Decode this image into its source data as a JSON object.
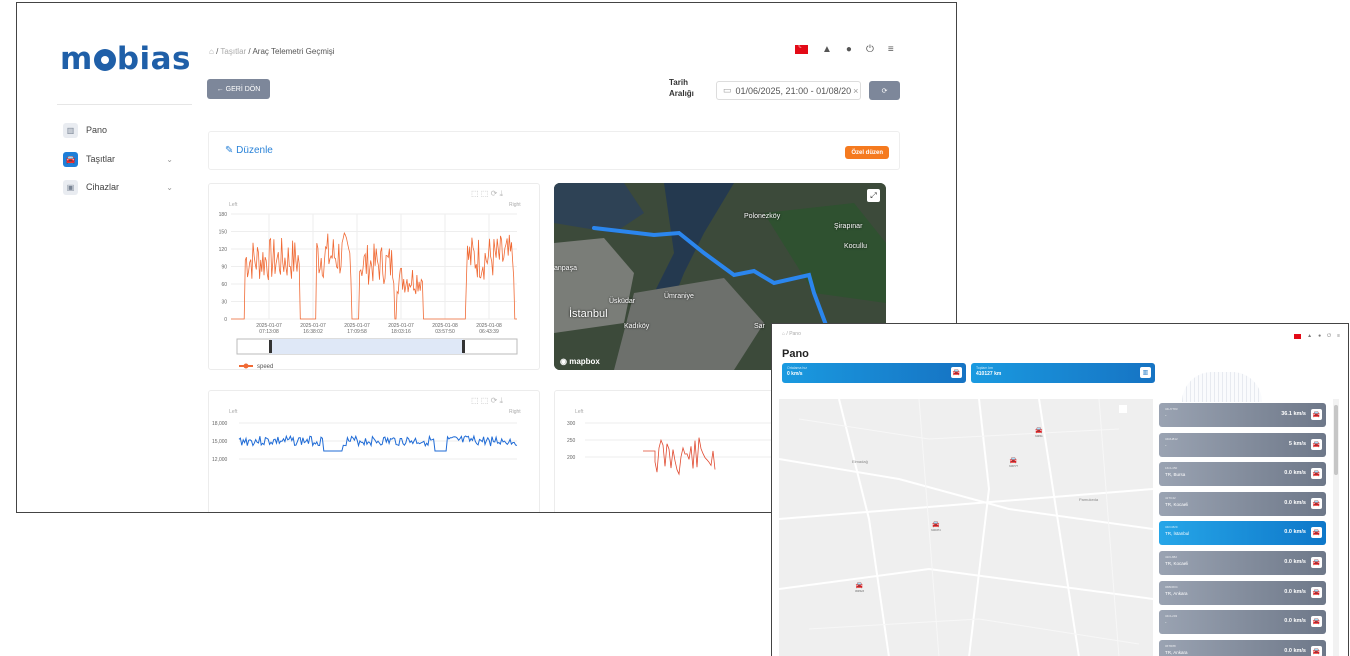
{
  "back_window": {
    "logo": {
      "pre": "m",
      "post": "bias"
    },
    "sidebar": [
      {
        "label": "Pano",
        "icon": "chart-icon",
        "glyph": "▥",
        "active": false
      },
      {
        "label": "Taşıtlar",
        "icon": "car-icon",
        "glyph": "🚘",
        "active": true
      },
      {
        "label": "Cihazlar",
        "icon": "device-icon",
        "glyph": "▣",
        "active": false
      }
    ],
    "breadcrumb": {
      "home": "⌂",
      "sep": "/",
      "parent": "Taşıtlar",
      "current": "Araç Telemetri Geçmişi"
    },
    "back_button": "← GERİ DÖN",
    "date": {
      "label_line1": "Tarih",
      "label_line2": "Aralığı",
      "value": "01/06/2025, 21:00 - 01/08/20",
      "clear": "×",
      "cal": "▭"
    },
    "edit": {
      "label": "Düzenle",
      "icon": "✎",
      "custom_btn": "Özel düzen"
    },
    "map": {
      "brand": "mapbox",
      "expand": "⤢",
      "labels": [
        "Polonezköy",
        "Şirapınar",
        "Kocullu",
        "Üsküdar",
        "Ümraniye",
        "İstanbul",
        "Kadıköy",
        "Sar",
        "anpaşa"
      ]
    }
  },
  "charts": {
    "speed": {
      "type": "line",
      "toolbar": "⬚ ⬚ ⟳ ⤓",
      "left_label": "Left",
      "right_label": "Right",
      "ylim": [
        0,
        180
      ],
      "yticks": [
        "180",
        "150",
        "120",
        "90",
        "60",
        "30",
        "0"
      ],
      "xticks": [
        [
          "2025-01-07",
          "07:13:08"
        ],
        [
          "2025-01-07",
          "16:38:02"
        ],
        [
          "2025-01-07",
          "17:09:58"
        ],
        [
          "2025-01-07",
          "18:03:16"
        ],
        [
          "2025-01-08",
          "03:57:50"
        ],
        [
          "2025-01-08",
          "06:43:39"
        ]
      ],
      "series": [
        {
          "name": "speed",
          "color": "#f06a35"
        }
      ],
      "bursts": [
        [
          0.05,
          0.24,
          140
        ],
        [
          0.3,
          0.42,
          150
        ],
        [
          0.45,
          0.57,
          130
        ],
        [
          0.58,
          0.67,
          95
        ],
        [
          0.82,
          0.99,
          145
        ]
      ]
    },
    "bottom_left": {
      "type": "line",
      "toolbar": "⬚ ⬚ ⟳ ⤓",
      "left_label": "Left",
      "right_label": "Right",
      "yticks": [
        "18,000",
        "15,000",
        "12,000"
      ],
      "color": "#1f6bd6"
    },
    "bottom_right": {
      "type": "line",
      "left_label": "Left",
      "yticks": [
        "300",
        "250",
        "200"
      ],
      "color": "#e0492f"
    }
  },
  "front_window": {
    "breadcrumb": "⌂ / Pano",
    "title": "Pano",
    "stats": [
      {
        "label": "Ortalama hız",
        "value": "0 km/s",
        "icon": "car-icon",
        "glyph": "🚘"
      },
      {
        "label": "Toplam km",
        "value": "410127 km",
        "icon": "chart-icon",
        "glyph": "▥"
      }
    ],
    "map_cars": [
      {
        "code": "34RS1",
        "x": 256,
        "y": 30
      },
      {
        "code": "34KH77",
        "x": 230,
        "y": 60
      },
      {
        "code": "34DCH4",
        "x": 152,
        "y": 124
      },
      {
        "code": "06RS23",
        "x": 76,
        "y": 185
      }
    ],
    "map_labels": [
      "Elmadağ",
      "Pamukeda"
    ],
    "vehicles": [
      {
        "code": "34HY783",
        "city": "-",
        "speed": "36.1 km/s",
        "active": false
      },
      {
        "code": "34RH812",
        "city": "-",
        "speed": "5 km/s",
        "active": false
      },
      {
        "code": "16CL450",
        "city": "TR, Bursa",
        "speed": "0.0 km/s",
        "active": false
      },
      {
        "code": "41TC42",
        "city": "TR, Kocaeli",
        "speed": "0.0 km/s",
        "active": false
      },
      {
        "code": "34KC829",
        "city": "TR, İstanbul",
        "speed": "0.0 km/s",
        "active": true
      },
      {
        "code": "41KL882",
        "city": "TR, Kocaeli",
        "speed": "0.0 km/s",
        "active": false
      },
      {
        "code": "06BD604",
        "city": "TR, Ankara",
        "speed": "0.0 km/s",
        "active": false
      },
      {
        "code": "34CL293",
        "city": "-",
        "speed": "0.0 km/s",
        "active": false
      },
      {
        "code": "06TR88",
        "city": "TR, Ankara",
        "speed": "0.0 km/s",
        "active": false
      }
    ]
  }
}
